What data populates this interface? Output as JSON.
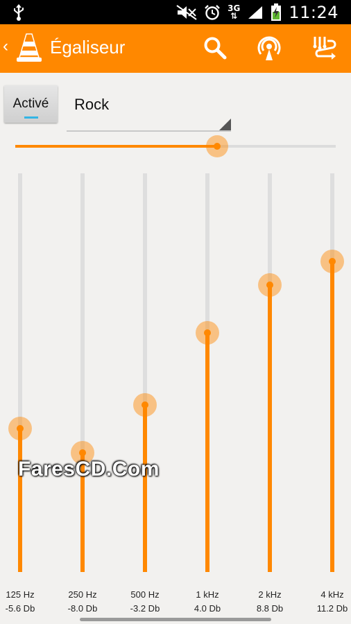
{
  "status_bar": {
    "network": "3G",
    "time": "11:24",
    "icons": [
      "usb-icon",
      "mute-icon",
      "alarm-icon",
      "signal-icon",
      "battery-icon"
    ]
  },
  "action_bar": {
    "title": "Égaliseur",
    "actions": [
      "search-icon",
      "hotspot-icon",
      "equalizer-reset-icon"
    ],
    "color": "#ff8800"
  },
  "toggle": {
    "label": "Activé",
    "on": true
  },
  "preset": {
    "selected": "Rock"
  },
  "preamp": {
    "value_percent": 63
  },
  "bands": [
    {
      "freq": "125 Hz",
      "gain": "-5.6 Db",
      "db": -5.6
    },
    {
      "freq": "250 Hz",
      "gain": "-8.0 Db",
      "db": -8.0
    },
    {
      "freq": "500 Hz",
      "gain": "-3.2 Db",
      "db": -3.2
    },
    {
      "freq": "1 kHz",
      "gain": "4.0 Db",
      "db": 4.0
    },
    {
      "freq": "2 kHz",
      "gain": "8.8 Db",
      "db": 8.8
    },
    {
      "freq": "4 kHz",
      "gain": "11.2 Db",
      "db": 11.2
    }
  ],
  "band_range_db": [
    -20,
    20
  ],
  "watermark": "FaresCD.Com"
}
